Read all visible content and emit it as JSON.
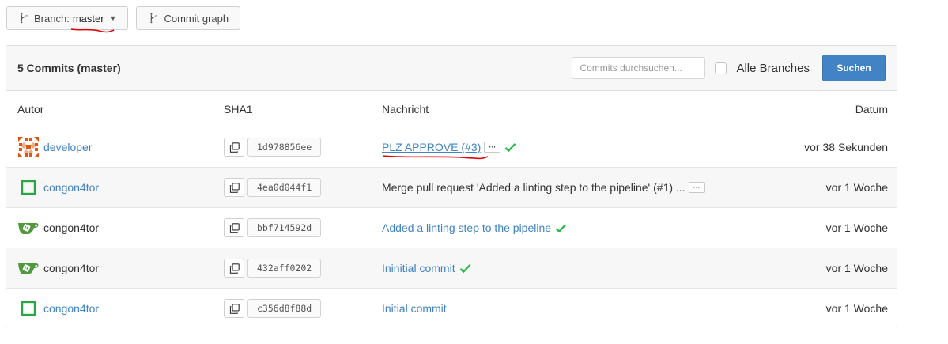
{
  "toolbar": {
    "branch_label": "Branch:",
    "branch_value": "master",
    "commit_graph_label": "Commit graph"
  },
  "panel": {
    "title": "5 Commits (master)",
    "search_placeholder": "Commits durchsuchen...",
    "all_branches_label": "Alle Branches",
    "search_button": "Suchen"
  },
  "table": {
    "headers": {
      "author": "Autor",
      "sha": "SHA1",
      "message": "Nachricht",
      "date": "Datum"
    },
    "rows": [
      {
        "author": "developer",
        "sha": "1d978856ee",
        "message": "PLZ APPROVE (#3)",
        "date": "vor 38 Sekunden"
      },
      {
        "author": "congon4tor",
        "sha": "4ea0d044f1",
        "message": "Merge pull request 'Added a linting step to the pipeline' (#1) ...",
        "date": "vor 1 Woche"
      },
      {
        "author": "congon4tor",
        "sha": "bbf714592d",
        "message": "Added a linting step to the pipeline",
        "date": "vor 1 Woche"
      },
      {
        "author": "congon4tor",
        "sha": "432aff0202",
        "message": "Ininitial commit",
        "date": "vor 1 Woche"
      },
      {
        "author": "congon4tor",
        "sha": "c356d8f88d",
        "message": "Initial commit",
        "date": "vor 1 Woche"
      }
    ]
  },
  "colors": {
    "link": "#4183c4",
    "success": "#21ba45",
    "annotation": "#e00000",
    "avatar_green": "#28a745",
    "avatar_orange": "#e0560e"
  },
  "icons": {
    "branch": "branch-icon",
    "graph": "commit-graph-icon",
    "copy": "copy-icon",
    "check": "check-icon",
    "gitea": "gitea-logo-icon"
  }
}
